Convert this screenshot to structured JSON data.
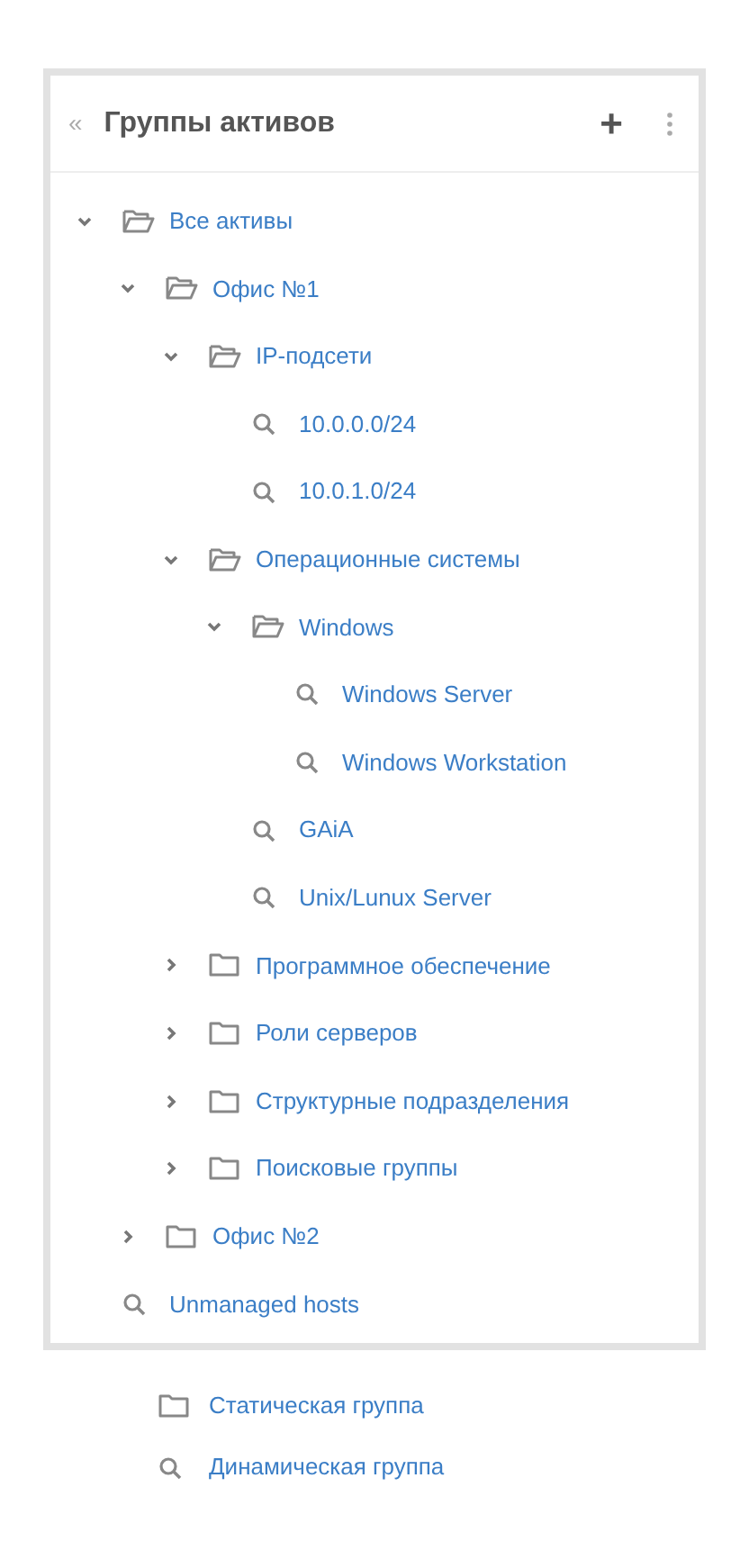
{
  "panel": {
    "title": "Группы активов",
    "collapse_label": "«",
    "add_label": "+"
  },
  "tree": [
    {
      "kind": "static",
      "label": "Все активы",
      "expanded": true,
      "children": [
        {
          "kind": "static",
          "label": "Офис №1",
          "expanded": true,
          "children": [
            {
              "kind": "static",
              "label": "IP-подсети",
              "expanded": true,
              "children": [
                {
                  "kind": "dynamic",
                  "label": "10.0.0.0/24"
                },
                {
                  "kind": "dynamic",
                  "label": "10.0.1.0/24"
                }
              ]
            },
            {
              "kind": "static",
              "label": "Операционные системы",
              "expanded": true,
              "children": [
                {
                  "kind": "static",
                  "label": "Windows",
                  "expanded": true,
                  "children": [
                    {
                      "kind": "dynamic",
                      "label": "Windows Server"
                    },
                    {
                      "kind": "dynamic",
                      "label": "Windows Workstation"
                    }
                  ]
                },
                {
                  "kind": "dynamic",
                  "label": "GAiA"
                },
                {
                  "kind": "dynamic",
                  "label": "Unix/Lunux Server"
                }
              ]
            },
            {
              "kind": "static",
              "label": "Программное обеспечение",
              "expanded": false
            },
            {
              "kind": "static",
              "label": "Роли серверов",
              "expanded": false
            },
            {
              "kind": "static",
              "label": "Структурные подразделения",
              "expanded": false
            },
            {
              "kind": "static",
              "label": "Поисковые группы",
              "expanded": false
            }
          ]
        },
        {
          "kind": "static",
          "label": "Офис №2",
          "expanded": false
        }
      ]
    },
    {
      "kind": "dynamic",
      "label": "Unmanaged hosts"
    }
  ],
  "legend": [
    {
      "kind": "static",
      "label": "Статическая группа"
    },
    {
      "kind": "dynamic",
      "label": "Динамическая группа"
    }
  ]
}
